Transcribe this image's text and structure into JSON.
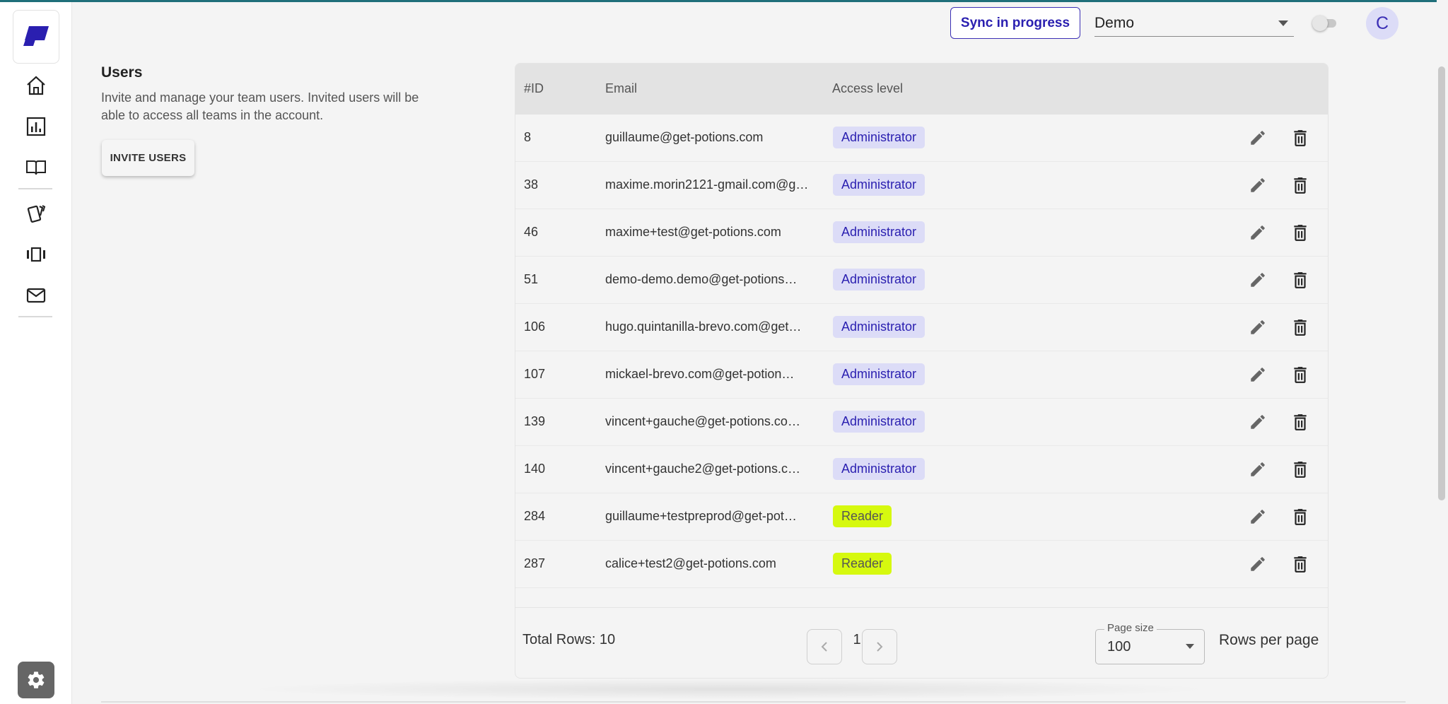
{
  "header": {
    "sync_label": "Sync in progress",
    "team_selected": "Demo",
    "avatar_initial": "C"
  },
  "users_section": {
    "title": "Users",
    "description": "Invite and manage your team users. Invited users will be able to access all teams in the account.",
    "invite_label": "INVITE USERS"
  },
  "table": {
    "columns": [
      "#ID",
      "Email",
      "Access level"
    ],
    "rows": [
      {
        "id": "8",
        "email": "guillaume@get-potions.com",
        "access": "Administrator"
      },
      {
        "id": "38",
        "email": "maxime.morin2121-gmail.com@g…",
        "access": "Administrator"
      },
      {
        "id": "46",
        "email": "maxime+test@get-potions.com",
        "access": "Administrator"
      },
      {
        "id": "51",
        "email": "demo-demo.demo@get-potions…",
        "access": "Administrator"
      },
      {
        "id": "106",
        "email": "hugo.quintanilla-brevo.com@get…",
        "access": "Administrator"
      },
      {
        "id": "107",
        "email": "mickael-brevo.com@get-potion…",
        "access": "Administrator"
      },
      {
        "id": "139",
        "email": "vincent+gauche@get-potions.co…",
        "access": "Administrator"
      },
      {
        "id": "140",
        "email": "vincent+gauche2@get-potions.c…",
        "access": "Administrator"
      },
      {
        "id": "284",
        "email": "guillaume+testpreprod@get-pot…",
        "access": "Reader"
      },
      {
        "id": "287",
        "email": "calice+test2@get-potions.com",
        "access": "Reader"
      }
    ],
    "footer": {
      "total_rows": "Total Rows: 10",
      "current_page": "1",
      "page_size_label": "Page size",
      "page_size_value": "100",
      "rows_per_page_label": "Rows per page"
    }
  },
  "colors": {
    "brand": "#3b2fb5",
    "admin_badge_bg": "#dcdcf7",
    "reader_badge_bg": "#d6f90f"
  },
  "icons": {
    "sidebar": [
      "home-icon",
      "chart-icon",
      "book-icon",
      "cards-icon",
      "carousel-icon",
      "mail-icon"
    ],
    "settings": "gear-icon",
    "row_actions": [
      "pencil-icon",
      "trash-icon"
    ]
  }
}
